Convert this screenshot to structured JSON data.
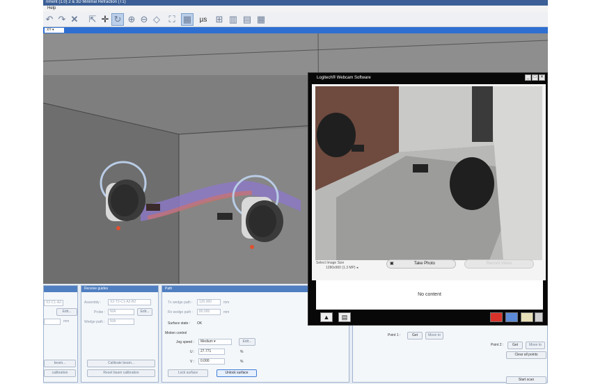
{
  "app": {
    "title": "nment (1.0) 2 & 3D Minimal Refraction (T1)",
    "menu": [
      "Help"
    ],
    "view_select": "XY",
    "toolbar_icons": [
      "undo-icon",
      "redo-icon",
      "delete-icon",
      "select-arrow-icon",
      "move-icon",
      "rotate-icon",
      "zoom-in-icon",
      "zoom-out-icon",
      "measure-icon",
      "fit-view-icon",
      "grid-icon",
      "microsecond-icon",
      "layout-single-icon",
      "layout-split-icon",
      "layout-quad-icon",
      "layout-grid-icon"
    ],
    "toolbar_us_label": "µs"
  },
  "panels": {
    "left": {
      "probe_id": "X2-C1-A2-B1",
      "edit_label": "Edit...",
      "unit_label": "mm",
      "beam_button": "beam...",
      "calibration_button": "calibration"
    },
    "receive": {
      "header": "Receive guides",
      "assembly_label": "Assembly :",
      "assembly_value": "X2-T2-C1-A2-B2",
      "probe_label": "Probe :",
      "probe_value": "N/A",
      "wedge_label": "Wedge path :",
      "wedge_value": "N/A",
      "edit_label": "Edit...",
      "calibrate_button": "Calibrate beam...",
      "reset_button": "Reset beam calibration"
    },
    "path": {
      "header": "Path",
      "tx_label": "Tx wedge path :",
      "tx_value": "120.000",
      "rx_label": "Rx wedge path :",
      "rx_value": "80.000",
      "unit": "mm",
      "surface_label": "Surface state :",
      "surface_value": "OK",
      "motion_label": "Motion control",
      "jog_label": "Jog speed :",
      "jog_value": "Medium",
      "u_label": "U :",
      "u_value": "27.771",
      "v_label": "V :",
      "v_value": "0.000",
      "percent": "%",
      "edit_label": "Edit...",
      "lock_button": "Lock surface",
      "unlock_button": "Unlock surface"
    },
    "points": {
      "point1_label": "Point 1 :",
      "point2_label": "Point 2 :",
      "get_label": "Get",
      "move_label": "Move to",
      "clear_button": "Clear all points",
      "start_button": "Start scan"
    }
  },
  "webcam": {
    "title": "Logitech® Webcam Software",
    "image_size_label": "Select Image Size",
    "image_size_value": "1280x960 (1.3 MP)",
    "take_photo": "Take Photo",
    "record_video": "Record Video",
    "no_content": "No content",
    "bottom_icons": [
      "photo-mode-icon",
      "video-mode-icon",
      "youtube-icon",
      "edit-icon",
      "email-icon",
      "trash-icon"
    ]
  }
}
